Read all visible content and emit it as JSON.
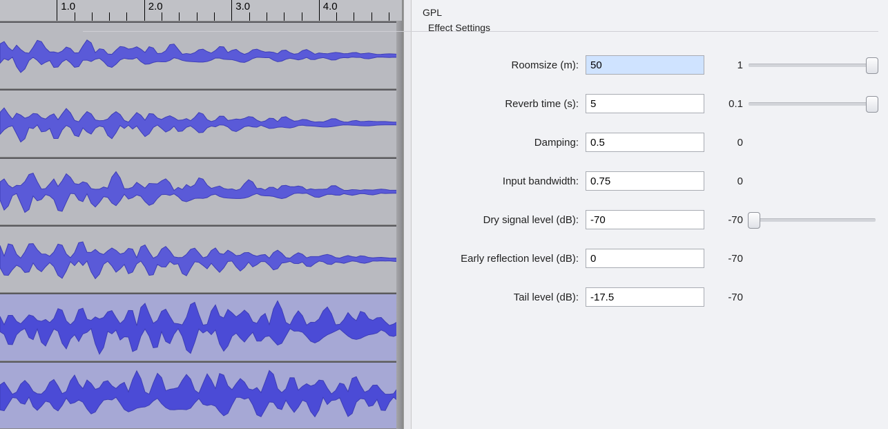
{
  "ruler": {
    "ticks": [
      "1.0",
      "2.0",
      "3.0",
      "4.0"
    ]
  },
  "tracks": [
    {
      "selected": false
    },
    {
      "selected": false
    },
    {
      "selected": false
    },
    {
      "selected": false
    },
    {
      "selected": true
    },
    {
      "selected": true
    }
  ],
  "dialog": {
    "subtitle": "GPL",
    "group": "Effect Settings",
    "params": [
      {
        "key": "roomsize",
        "label": "Roomsize (m):",
        "value": "50",
        "min": "1",
        "thumb": 0.97,
        "selected": true
      },
      {
        "key": "reverbtime",
        "label": "Reverb time (s):",
        "value": "5",
        "min": "0.1",
        "thumb": 0.97,
        "selected": false,
        "cursor": true
      },
      {
        "key": "damping",
        "label": "Damping:",
        "value": "0.5",
        "min": "0",
        "thumb": null,
        "selected": false
      },
      {
        "key": "inputbw",
        "label": "Input bandwidth:",
        "value": "0.75",
        "min": "0",
        "thumb": null,
        "selected": false
      },
      {
        "key": "drylevel",
        "label": "Dry signal level (dB):",
        "value": "-70",
        "min": "-70",
        "thumb": 0.04,
        "selected": false
      },
      {
        "key": "earlyrefl",
        "label": "Early reflection level (dB):",
        "value": "0",
        "min": "-70",
        "thumb": null,
        "selected": false
      },
      {
        "key": "taillevel",
        "label": "Tail level (dB):",
        "value": "-17.5",
        "min": "-70",
        "thumb": null,
        "selected": false
      }
    ]
  }
}
